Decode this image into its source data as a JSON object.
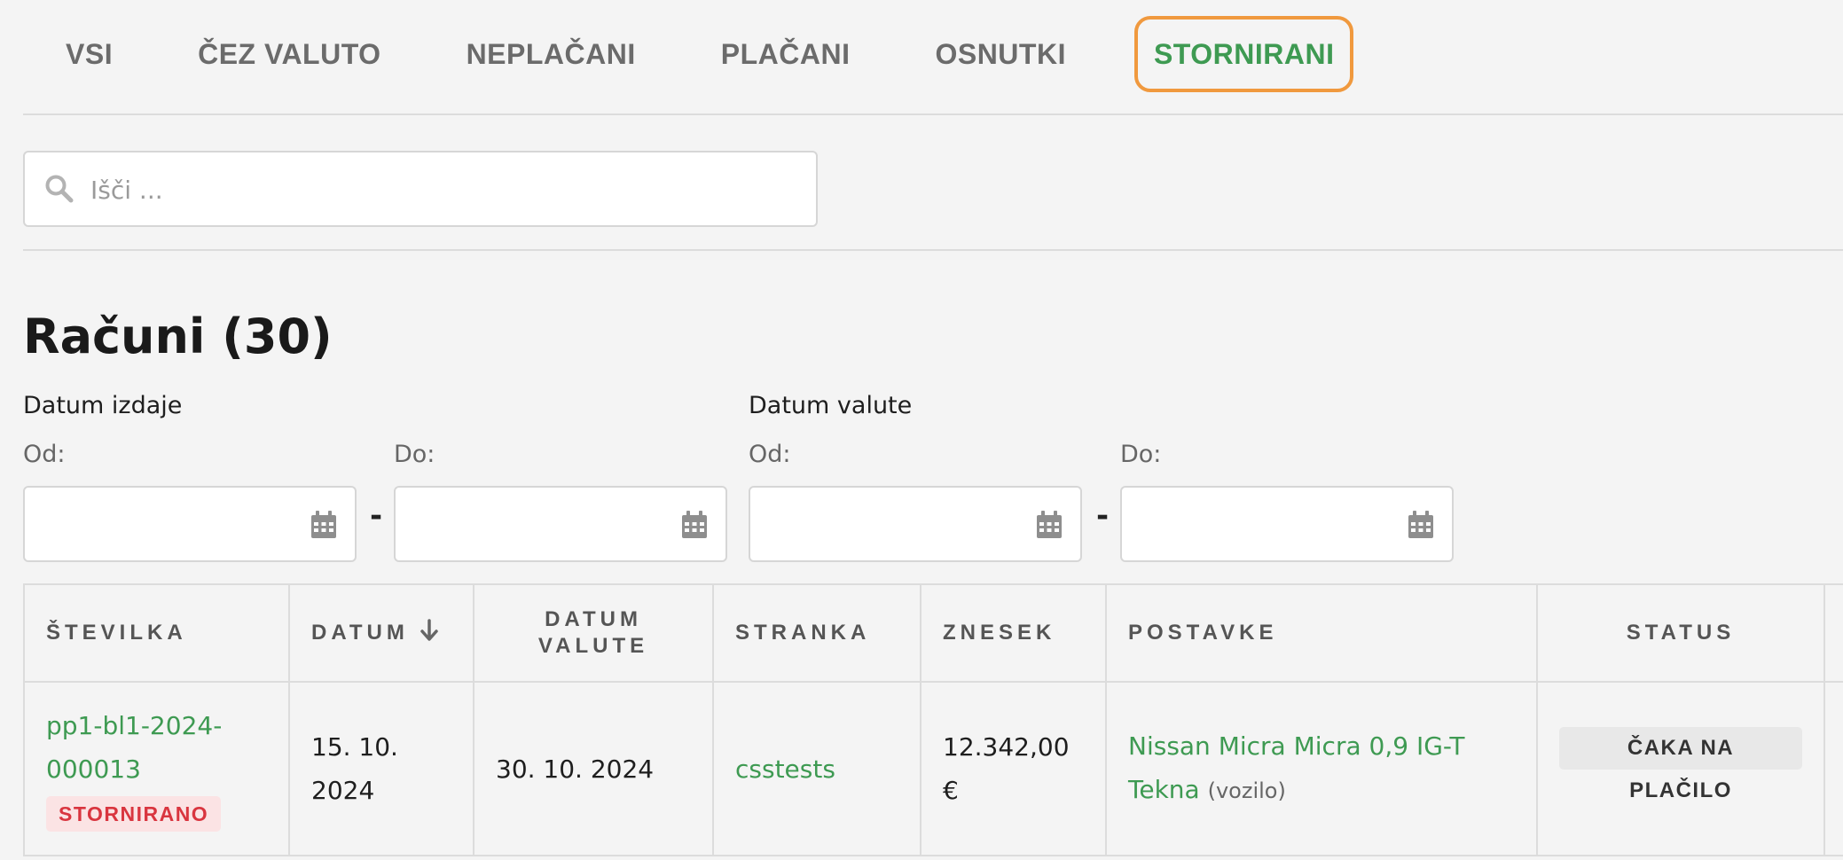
{
  "tabs": [
    {
      "label": "VSI",
      "active": false
    },
    {
      "label": "ČEZ VALUTO",
      "active": false
    },
    {
      "label": "NEPLAČANI",
      "active": false
    },
    {
      "label": "PLAČANI",
      "active": false
    },
    {
      "label": "OSNUTKI",
      "active": false
    },
    {
      "label": "STORNIRANI",
      "active": true
    }
  ],
  "search": {
    "placeholder": "Išči ...",
    "value": ""
  },
  "page_title": "Računi (30)",
  "filters": {
    "issue_date": {
      "label": "Datum izdaje",
      "from_label": "Od:",
      "to_label": "Do:",
      "from_value": "",
      "to_value": ""
    },
    "due_date": {
      "label": "Datum valute",
      "from_label": "Od:",
      "to_label": "Do:",
      "from_value": "",
      "to_value": ""
    },
    "separator": "-"
  },
  "table": {
    "headers": {
      "number": "ŠTEVILKA",
      "date": "DATUM",
      "due_date": "DATUM VALUTE",
      "client": "STRANKA",
      "amount": "ZNESEK",
      "items": "POSTAVKE",
      "status": "STATUS"
    },
    "sort": {
      "column": "date",
      "direction": "descending"
    },
    "rows": [
      {
        "number": "pp1-bl1-2024-000013",
        "number_badge": "STORNIRANO",
        "date": "15. 10. 2024",
        "due_date": "30. 10. 2024",
        "client": "csstests",
        "amount": "12.342,00 €",
        "item_name": "Nissan Micra Micra 0,9 IG-T Tekna",
        "item_type": "(vozilo)",
        "status": "ČAKA NA PLAČILO"
      }
    ]
  },
  "colors": {
    "accent_green": "#3e9a52",
    "active_tab_border": "#f0993e",
    "cancelled_badge_text": "#d9353f",
    "cancelled_badge_bg": "#fbe3e4"
  }
}
